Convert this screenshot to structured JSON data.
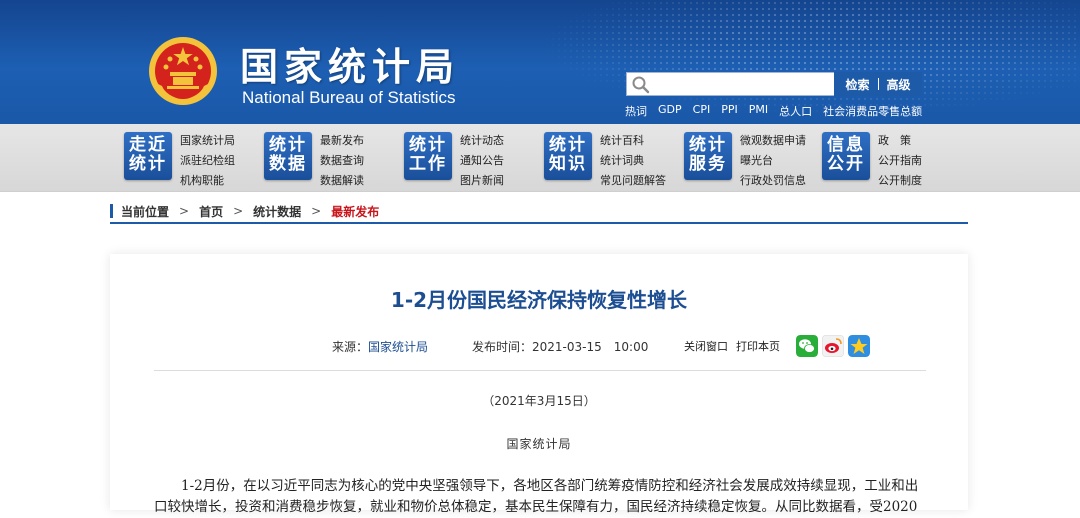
{
  "header": {
    "title_cn": "国家统计局",
    "title_en": "National Bureau of Statistics",
    "search": {
      "placeholder": "",
      "search_label": "检索",
      "advanced_label": "高级"
    },
    "hot_words": [
      "热词",
      "GDP",
      "CPI",
      "PPI",
      "PMI",
      "总人口",
      "社会消费品零售总额"
    ]
  },
  "nav": [
    {
      "badge": [
        "走近",
        "统计"
      ],
      "links": [
        "国家统计局",
        "派驻纪检组",
        "机构职能"
      ]
    },
    {
      "badge": [
        "统计",
        "数据"
      ],
      "links": [
        "最新发布",
        "数据查询",
        "数据解读"
      ]
    },
    {
      "badge": [
        "统计",
        "工作"
      ],
      "links": [
        "统计动态",
        "通知公告",
        "图片新闻"
      ]
    },
    {
      "badge": [
        "统计",
        "知识"
      ],
      "links": [
        "统计百科",
        "统计词典",
        "常见问题解答"
      ]
    },
    {
      "badge": [
        "统计",
        "服务"
      ],
      "links": [
        "微观数据申请",
        "曝光台",
        "行政处罚信息"
      ]
    },
    {
      "badge": [
        "信息",
        "公开"
      ],
      "links": [
        "政　策",
        "公开指南",
        "公开制度"
      ]
    }
  ],
  "breadcrumb": {
    "label": "当前位置",
    "items": [
      "首页",
      "统计数据",
      "最新发布"
    ]
  },
  "article": {
    "title": "1-2月份国民经济保持恢复性增长",
    "source_label": "来源：",
    "source": "国家统计局",
    "time_label": "发布时间：",
    "time": "2021-03-15　10:00",
    "close_label": "关闭窗口",
    "print_label": "打印本页",
    "date_line": "（2021年3月15日）",
    "author_line": "国家统计局",
    "paragraph": "1-2月份，在以习近平同志为核心的党中央坚强领导下，各地区各部门统筹疫情防控和经济社会发展成效持续显现，工业和出口较快增长，投资和消费稳步恢复，就业和物价总体稳定，基本民生保障有力，国民经济持续稳定恢复。从同比数据看，受2020"
  },
  "colors": {
    "header_blue": "#1d5fb3",
    "title_blue": "#1d4e92",
    "current_red": "#c8161d"
  },
  "icons": [
    "national-emblem-icon",
    "search-icon",
    "wechat-icon",
    "weibo-icon",
    "qzone-icon"
  ]
}
